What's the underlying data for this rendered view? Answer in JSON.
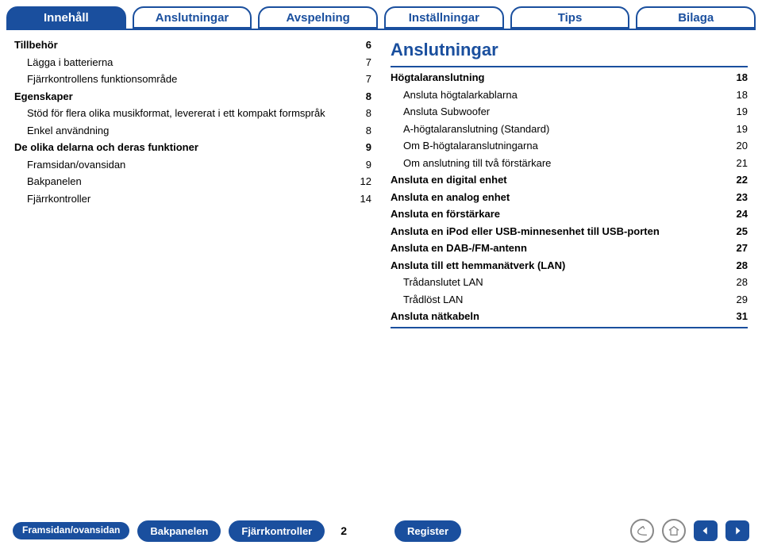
{
  "colors": {
    "accent": "#1a4f9e"
  },
  "tabs": {
    "items": [
      {
        "label": "Innehåll",
        "active": true
      },
      {
        "label": "Anslutningar",
        "active": false
      },
      {
        "label": "Avspelning",
        "active": false
      },
      {
        "label": "Inställningar",
        "active": false
      },
      {
        "label": "Tips",
        "active": false
      },
      {
        "label": "Bilaga",
        "active": false
      }
    ]
  },
  "left": {
    "items": [
      {
        "label": "Tillbehör",
        "page": "6",
        "bold": true,
        "indent": 0
      },
      {
        "label": "Lägga i batterierna",
        "page": "7",
        "bold": false,
        "indent": 1
      },
      {
        "label": "Fjärrkontrollens funktionsområde",
        "page": "7",
        "bold": false,
        "indent": 1
      },
      {
        "label": "Egenskaper",
        "page": "8",
        "bold": true,
        "indent": 0
      },
      {
        "label": "Stöd för flera olika musikformat, levererat i ett kompakt formspråk",
        "page": "8",
        "bold": false,
        "indent": 1
      },
      {
        "label": "Enkel användning",
        "page": "8",
        "bold": false,
        "indent": 1
      },
      {
        "label": "De olika delarna och deras funktioner",
        "page": "9",
        "bold": true,
        "indent": 0
      },
      {
        "label": "Framsidan/ovansidan",
        "page": "9",
        "bold": false,
        "indent": 1
      },
      {
        "label": "Bakpanelen",
        "page": "12",
        "bold": false,
        "indent": 1
      },
      {
        "label": "Fjärrkontroller",
        "page": "14",
        "bold": false,
        "indent": 1
      }
    ]
  },
  "right": {
    "heading": "Anslutningar",
    "items": [
      {
        "label": "Högtalaranslutning",
        "page": "18",
        "bold": true,
        "indent": 0
      },
      {
        "label": "Ansluta högtalarkablarna",
        "page": "18",
        "bold": false,
        "indent": 1
      },
      {
        "label": "Ansluta Subwoofer",
        "page": "19",
        "bold": false,
        "indent": 1
      },
      {
        "label": "A-högtalaranslutning (Standard)",
        "page": "19",
        "bold": false,
        "indent": 1
      },
      {
        "label": "Om B-högtalaranslutningarna",
        "page": "20",
        "bold": false,
        "indent": 1
      },
      {
        "label": "Om anslutning till två förstärkare",
        "page": "21",
        "bold": false,
        "indent": 1
      },
      {
        "label": "Ansluta en digital enhet",
        "page": "22",
        "bold": true,
        "indent": 0
      },
      {
        "label": "Ansluta en analog enhet",
        "page": "23",
        "bold": true,
        "indent": 0
      },
      {
        "label": "Ansluta en förstärkare",
        "page": "24",
        "bold": true,
        "indent": 0
      },
      {
        "label": "Ansluta en iPod eller USB-minnesenhet till USB-porten",
        "page": "25",
        "bold": true,
        "indent": 0
      },
      {
        "label": "Ansluta en DAB-/FM-antenn",
        "page": "27",
        "bold": true,
        "indent": 0
      },
      {
        "label": "Ansluta till ett hemmanätverk (LAN)",
        "page": "28",
        "bold": true,
        "indent": 0
      },
      {
        "label": "Trådanslutet LAN",
        "page": "28",
        "bold": false,
        "indent": 1
      },
      {
        "label": "Trådlöst LAN",
        "page": "29",
        "bold": false,
        "indent": 1
      },
      {
        "label": "Ansluta nätkabeln",
        "page": "31",
        "bold": true,
        "indent": 0
      }
    ]
  },
  "bottom": {
    "framsidan": "Framsidan/\novansidan",
    "bakpanelen": "Bakpanelen",
    "fjarrkontroller": "Fjärrkontroller",
    "page_number": "2",
    "register": "Register"
  }
}
